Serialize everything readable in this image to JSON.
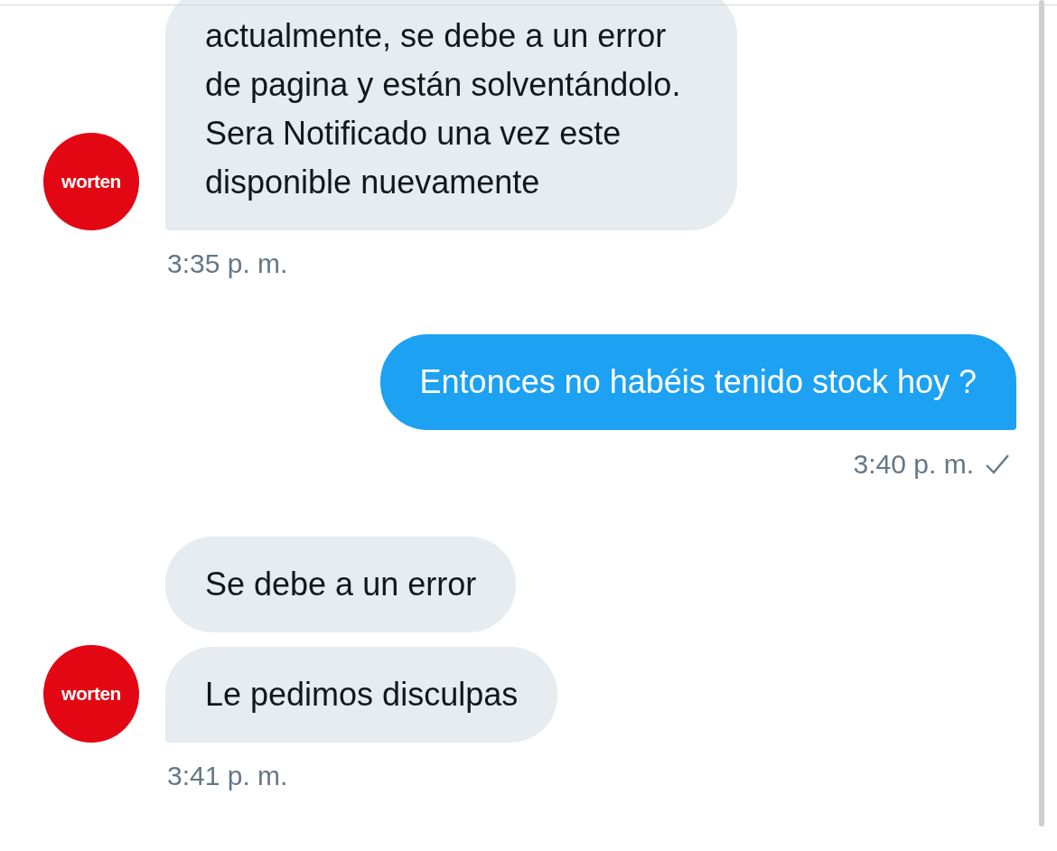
{
  "messages": [
    {
      "kind": "incoming",
      "avatar": "worten",
      "bubbles": [
        "actualmente, se debe a un error de pagina y están solventándolo. Sera Notificado una vez este disponible nuevamente"
      ],
      "time": "3:35 p. m."
    },
    {
      "kind": "outgoing",
      "bubbles": [
        "Entonces no habéis tenido stock hoy ?"
      ],
      "time": "3:40 p. m.",
      "delivered": true
    },
    {
      "kind": "incoming",
      "avatar": "worten",
      "bubbles": [
        "Se debe a un error",
        "Le pedimos disculpas"
      ],
      "time": "3:41 p. m."
    }
  ]
}
